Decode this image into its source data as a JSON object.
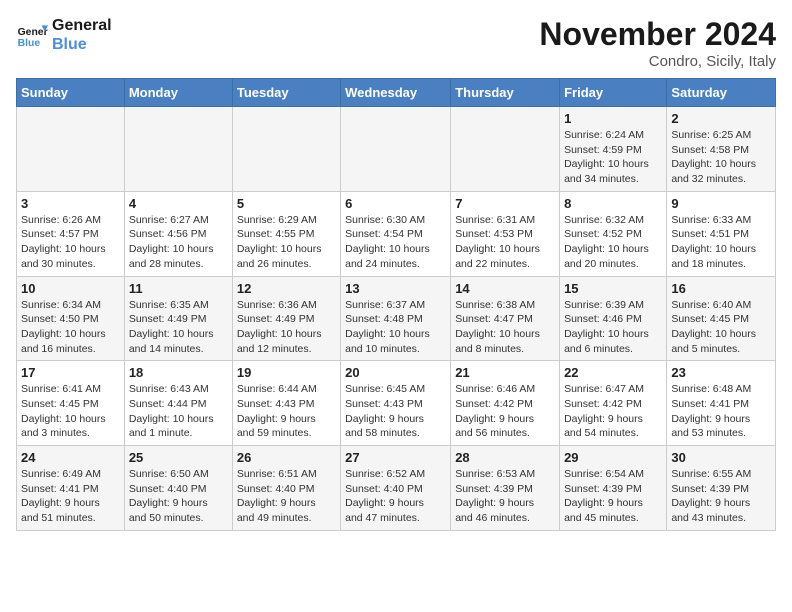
{
  "logo": {
    "line1": "General",
    "line2": "Blue"
  },
  "title": "November 2024",
  "location": "Condro, Sicily, Italy",
  "days_of_week": [
    "Sunday",
    "Monday",
    "Tuesday",
    "Wednesday",
    "Thursday",
    "Friday",
    "Saturday"
  ],
  "weeks": [
    [
      {
        "day": "",
        "info": ""
      },
      {
        "day": "",
        "info": ""
      },
      {
        "day": "",
        "info": ""
      },
      {
        "day": "",
        "info": ""
      },
      {
        "day": "",
        "info": ""
      },
      {
        "day": "1",
        "info": "Sunrise: 6:24 AM\nSunset: 4:59 PM\nDaylight: 10 hours\nand 34 minutes."
      },
      {
        "day": "2",
        "info": "Sunrise: 6:25 AM\nSunset: 4:58 PM\nDaylight: 10 hours\nand 32 minutes."
      }
    ],
    [
      {
        "day": "3",
        "info": "Sunrise: 6:26 AM\nSunset: 4:57 PM\nDaylight: 10 hours\nand 30 minutes."
      },
      {
        "day": "4",
        "info": "Sunrise: 6:27 AM\nSunset: 4:56 PM\nDaylight: 10 hours\nand 28 minutes."
      },
      {
        "day": "5",
        "info": "Sunrise: 6:29 AM\nSunset: 4:55 PM\nDaylight: 10 hours\nand 26 minutes."
      },
      {
        "day": "6",
        "info": "Sunrise: 6:30 AM\nSunset: 4:54 PM\nDaylight: 10 hours\nand 24 minutes."
      },
      {
        "day": "7",
        "info": "Sunrise: 6:31 AM\nSunset: 4:53 PM\nDaylight: 10 hours\nand 22 minutes."
      },
      {
        "day": "8",
        "info": "Sunrise: 6:32 AM\nSunset: 4:52 PM\nDaylight: 10 hours\nand 20 minutes."
      },
      {
        "day": "9",
        "info": "Sunrise: 6:33 AM\nSunset: 4:51 PM\nDaylight: 10 hours\nand 18 minutes."
      }
    ],
    [
      {
        "day": "10",
        "info": "Sunrise: 6:34 AM\nSunset: 4:50 PM\nDaylight: 10 hours\nand 16 minutes."
      },
      {
        "day": "11",
        "info": "Sunrise: 6:35 AM\nSunset: 4:49 PM\nDaylight: 10 hours\nand 14 minutes."
      },
      {
        "day": "12",
        "info": "Sunrise: 6:36 AM\nSunset: 4:49 PM\nDaylight: 10 hours\nand 12 minutes."
      },
      {
        "day": "13",
        "info": "Sunrise: 6:37 AM\nSunset: 4:48 PM\nDaylight: 10 hours\nand 10 minutes."
      },
      {
        "day": "14",
        "info": "Sunrise: 6:38 AM\nSunset: 4:47 PM\nDaylight: 10 hours\nand 8 minutes."
      },
      {
        "day": "15",
        "info": "Sunrise: 6:39 AM\nSunset: 4:46 PM\nDaylight: 10 hours\nand 6 minutes."
      },
      {
        "day": "16",
        "info": "Sunrise: 6:40 AM\nSunset: 4:45 PM\nDaylight: 10 hours\nand 5 minutes."
      }
    ],
    [
      {
        "day": "17",
        "info": "Sunrise: 6:41 AM\nSunset: 4:45 PM\nDaylight: 10 hours\nand 3 minutes."
      },
      {
        "day": "18",
        "info": "Sunrise: 6:43 AM\nSunset: 4:44 PM\nDaylight: 10 hours\nand 1 minute."
      },
      {
        "day": "19",
        "info": "Sunrise: 6:44 AM\nSunset: 4:43 PM\nDaylight: 9 hours\nand 59 minutes."
      },
      {
        "day": "20",
        "info": "Sunrise: 6:45 AM\nSunset: 4:43 PM\nDaylight: 9 hours\nand 58 minutes."
      },
      {
        "day": "21",
        "info": "Sunrise: 6:46 AM\nSunset: 4:42 PM\nDaylight: 9 hours\nand 56 minutes."
      },
      {
        "day": "22",
        "info": "Sunrise: 6:47 AM\nSunset: 4:42 PM\nDaylight: 9 hours\nand 54 minutes."
      },
      {
        "day": "23",
        "info": "Sunrise: 6:48 AM\nSunset: 4:41 PM\nDaylight: 9 hours\nand 53 minutes."
      }
    ],
    [
      {
        "day": "24",
        "info": "Sunrise: 6:49 AM\nSunset: 4:41 PM\nDaylight: 9 hours\nand 51 minutes."
      },
      {
        "day": "25",
        "info": "Sunrise: 6:50 AM\nSunset: 4:40 PM\nDaylight: 9 hours\nand 50 minutes."
      },
      {
        "day": "26",
        "info": "Sunrise: 6:51 AM\nSunset: 4:40 PM\nDaylight: 9 hours\nand 49 minutes."
      },
      {
        "day": "27",
        "info": "Sunrise: 6:52 AM\nSunset: 4:40 PM\nDaylight: 9 hours\nand 47 minutes."
      },
      {
        "day": "28",
        "info": "Sunrise: 6:53 AM\nSunset: 4:39 PM\nDaylight: 9 hours\nand 46 minutes."
      },
      {
        "day": "29",
        "info": "Sunrise: 6:54 AM\nSunset: 4:39 PM\nDaylight: 9 hours\nand 45 minutes."
      },
      {
        "day": "30",
        "info": "Sunrise: 6:55 AM\nSunset: 4:39 PM\nDaylight: 9 hours\nand 43 minutes."
      }
    ]
  ]
}
